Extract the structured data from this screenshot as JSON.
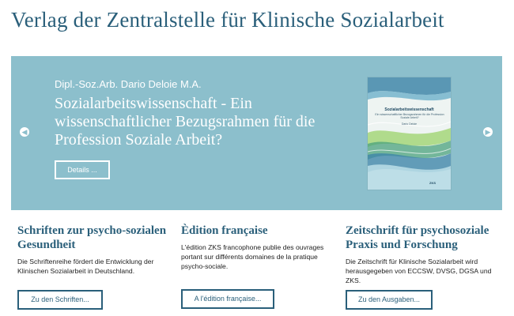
{
  "site": {
    "title": "Verlag der Zentralstelle für Klinische Sozialarbeit"
  },
  "slider": {
    "author": "Dipl.-Soz.Arb. Dario Deloie M.A.",
    "title": "Sozialarbeitswissenschaft - Ein wissenschaftlicher Bezugsrahmen für die Profession Soziale Arbeit?",
    "details_label": "Details ...",
    "prev_icon": "chevron-left-icon",
    "next_icon": "chevron-right-icon",
    "background_color": "#8cbfcc",
    "book": {
      "title": "Sozialarbeitswissenschaft",
      "subtitle": "Ein wissenschaftlicher Bezugsrahmen für die Profession Soziale Arbeit?",
      "author": "Dario Deloie",
      "logo": "ZKS"
    }
  },
  "columns": [
    {
      "heading": "Schriften zur psycho-sozialen Gesundheit",
      "text": "Die Schriftenreihe fördert die Entwicklung der Klinischen Sozialarbeit in Deutschland.",
      "button_label": "Zu den Schriften..."
    },
    {
      "heading": "Èdition française",
      "text": "L'édition ZKS francophone publie des ouvrages portant sur différents domaines de la pratique psycho-sociale.",
      "button_label": "A l'édition française..."
    },
    {
      "heading": "Zeitschrift für psychosoziale Praxis und Forschung",
      "text": "Die Zeitschrift für Klinische Sozialarbeit wird herausgegeben von ECCSW, DVSG, DGSA und ZKS.",
      "button_label": "Zu den Ausgaben..."
    }
  ],
  "colors": {
    "accent": "#2a5f7a",
    "slider_bg": "#8cbfcc"
  }
}
